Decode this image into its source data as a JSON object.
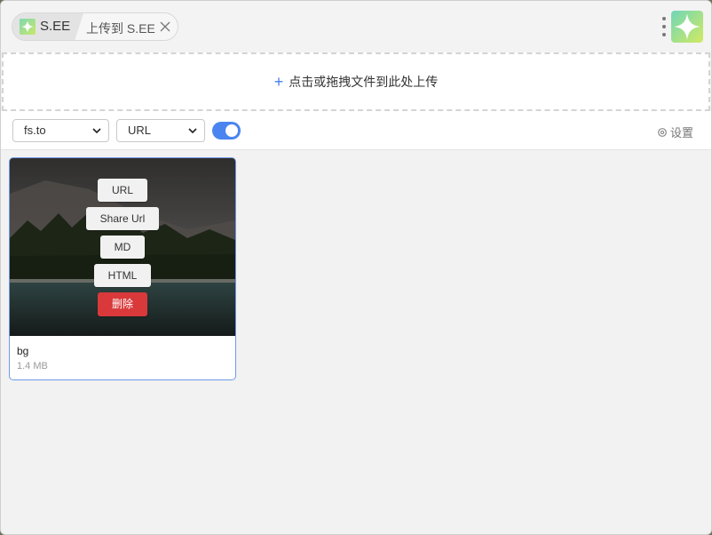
{
  "header": {
    "home_label": "S.EE",
    "page_label": "上传到 S.EE"
  },
  "upload": {
    "prompt": "点击或拖拽文件到此处上传"
  },
  "toolbar": {
    "host_select": {
      "value": "fs.to"
    },
    "format_select": {
      "value": "URL"
    },
    "toggle_on": true,
    "settings_label": "设置"
  },
  "files": [
    {
      "name": "bg",
      "size": "1.4 MB",
      "actions": {
        "url": "URL",
        "share_url": "Share Url",
        "md": "MD",
        "html": "HTML",
        "delete": "删除"
      }
    }
  ],
  "colors": {
    "accent": "#4a84f0",
    "danger": "#d9393b",
    "card_border": "#6f9ae6"
  },
  "icons": [
    "sparkle-logo-icon",
    "close-icon",
    "more-vertical-icon",
    "plus-icon",
    "chevron-down-icon",
    "gear-icon"
  ]
}
